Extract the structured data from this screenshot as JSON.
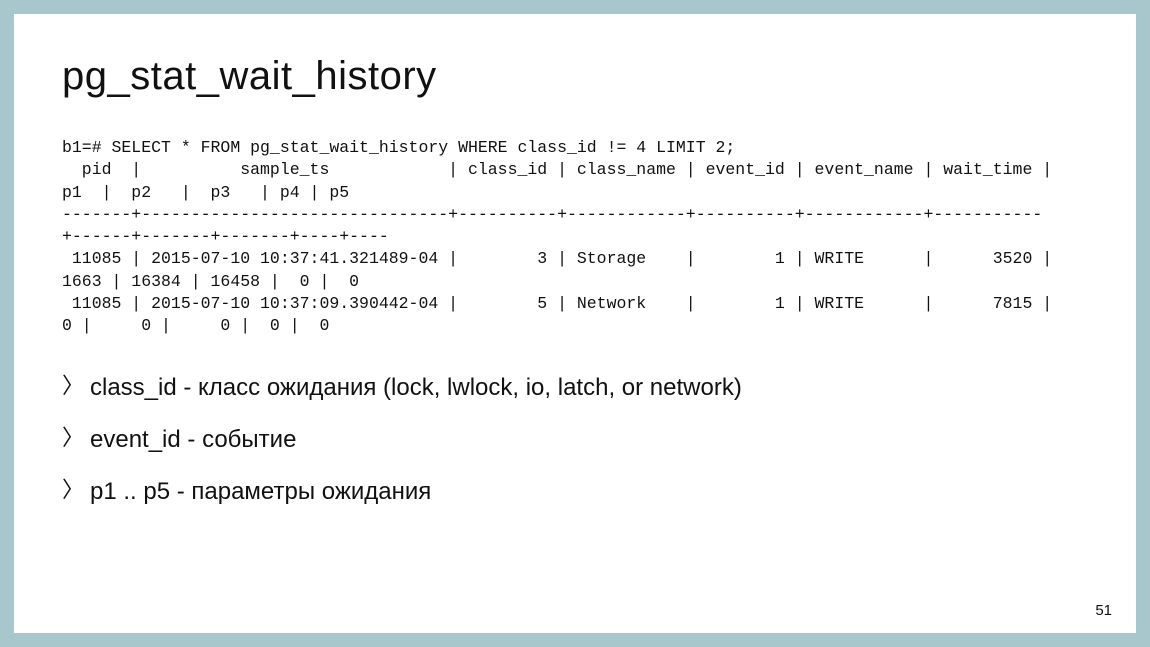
{
  "title": "pg_stat_wait_history",
  "code": "b1=# SELECT * FROM pg_stat_wait_history WHERE class_id != 4 LIMIT 2;\n  pid  |          sample_ts            | class_id | class_name | event_id | event_name | wait_time |\np1  |  p2   |  p3   | p4 | p5\n-------+-------------------------------+----------+------------+----------+------------+-----------\n+------+-------+-------+----+----\n 11085 | 2015-07-10 10:37:41.321489-04 |        3 | Storage    |        1 | WRITE      |      3520 |\n1663 | 16384 | 16458 |  0 |  0\n 11085 | 2015-07-10 10:37:09.390442-04 |        5 | Network    |        1 | WRITE      |      7815 |\n0 |     0 |     0 |  0 |  0",
  "bullets": [
    "class_id - класс ожидания (lock, lwlock, io, latch, or network)",
    "event_id - событие",
    "p1 .. p5 - параметры ожидания"
  ],
  "page_number": "51"
}
